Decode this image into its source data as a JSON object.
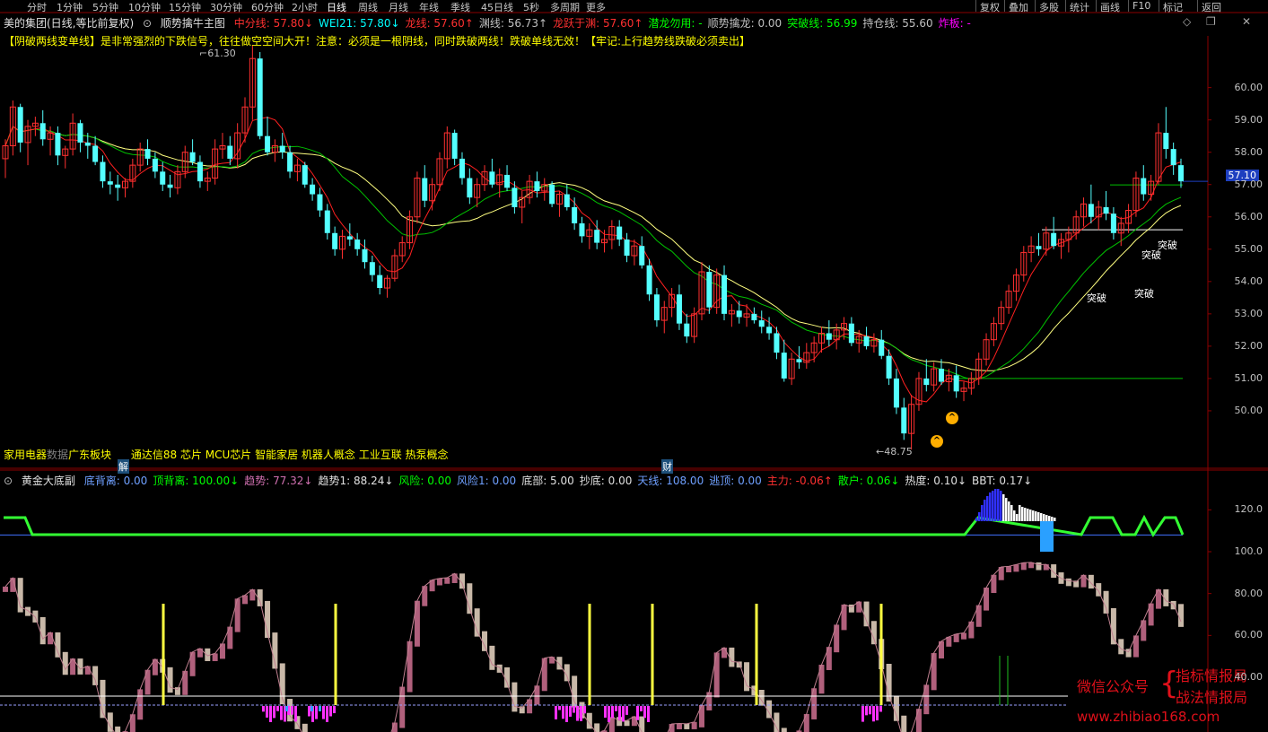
{
  "periods": [
    "分时",
    "1分钟",
    "5分钟",
    "10分钟",
    "15分钟",
    "30分钟",
    "60分钟",
    "2小时",
    "日线",
    "周线",
    "月线",
    "年线",
    "季线",
    "45日线",
    "5秒",
    "多周期",
    "更多"
  ],
  "active_period": "日线",
  "right_buttons": [
    "复权",
    "叠加",
    "多股",
    "统计",
    "画线",
    "F10",
    "标记",
    "返回"
  ],
  "header": {
    "stock_name": "美的集团(日线,等比前复权)",
    "indicator": "顺势擒牛主图",
    "items": [
      {
        "label": "中分线: 57.80↓",
        "color": "#ff3030"
      },
      {
        "label": "WEI21: 57.80↓",
        "color": "#00ffff"
      },
      {
        "label": "龙线: 57.60↑",
        "color": "#ff3030"
      },
      {
        "label": "渊线: 56.73↑",
        "color": "#c0c0c0"
      },
      {
        "label": "龙跃于渊: 57.60↑",
        "color": "#ff3030"
      },
      {
        "label": "潜龙勿用: -",
        "color": "#00ff00"
      },
      {
        "label": "顺势擒龙: 0.00",
        "color": "#c0c0c0"
      },
      {
        "label": "突破线: 56.99",
        "color": "#00ff00"
      },
      {
        "label": "持仓线: 55.60",
        "color": "#c0c0c0"
      },
      {
        "label": "炸板: -",
        "color": "#ff00ff"
      }
    ]
  },
  "notice": "【阴破两线变单线】是非常强烈的下跌信号，往往做空空间大开！注意：必须是一根阴线，同时跌破两线！跌破单线无效！【牢记:上行趋势线跌破必须卖出】",
  "high_label": "61.30",
  "low_label": "48.75",
  "current_price": "57.10",
  "price_axis": [
    "60.00",
    "59.00",
    "58.00",
    "57.00",
    "56.00",
    "55.00",
    "54.00",
    "53.00",
    "52.00",
    "51.00",
    "50.00"
  ],
  "sector": {
    "a": "家用电器",
    "b": "数据",
    "c": "广东板块",
    "d": "通达信88 芯片 MCU芯片 智能家居 机器人概念 工业互联 热泵概念"
  },
  "markers": {
    "jie": "解",
    "cai": "财"
  },
  "breakouts": [
    "突破",
    "突破",
    "突破",
    "突破"
  ],
  "sub_header": {
    "title": "黄金大底副",
    "items": [
      {
        "label": "底背离: 0.00",
        "color": "#6fa0ff"
      },
      {
        "label": "顶背离: 100.00↓",
        "color": "#00ff00"
      },
      {
        "label": "趋势: 77.32↓",
        "color": "#d070b0"
      },
      {
        "label": "趋势1: 88.24↓",
        "color": "#e0e0e0"
      },
      {
        "label": "风险: 0.00",
        "color": "#00ff00"
      },
      {
        "label": "风险1: 0.00",
        "color": "#6fa0ff"
      },
      {
        "label": "底部: 5.00",
        "color": "#e0e0e0"
      },
      {
        "label": "抄底: 0.00",
        "color": "#e0e0e0"
      },
      {
        "label": "天线: 108.00",
        "color": "#6fa0ff"
      },
      {
        "label": "逃顶: 0.00",
        "color": "#6fa0ff"
      },
      {
        "label": "主力: -0.06↑",
        "color": "#ff3030"
      },
      {
        "label": "散户: 0.06↓",
        "color": "#00ff00"
      },
      {
        "label": "热度: 0.10↓",
        "color": "#e0e0e0"
      },
      {
        "label": "BBT: 0.17↓",
        "color": "#e0e0e0"
      }
    ]
  },
  "sub_axis": [
    "120.0",
    "100.0",
    "80.00",
    "60.00",
    "40.00"
  ],
  "watermark": {
    "line1": "微信公众号",
    "line2a": "指标情报局",
    "line2b": "战法情报局",
    "url": "www.zhibiao168.com"
  },
  "colors": {
    "up": "#ff3030",
    "down": "#54ffff",
    "ma_red": "#ff2020",
    "ma_yellow": "#ffff80",
    "ma_green": "#00c000",
    "pink": "#b0607c",
    "beige": "#c8b8a8",
    "green_band": "#33ff33",
    "blue_band": "#3030ff"
  },
  "chart_data": {
    "type": "candlestick",
    "price_range": [
      48.5,
      61.6
    ],
    "candles": [
      [
        57.8,
        58.4,
        57.2,
        58.2
      ],
      [
        58.2,
        59.6,
        57.9,
        59.4
      ],
      [
        59.4,
        59.5,
        58.0,
        58.3
      ],
      [
        58.3,
        59.0,
        57.6,
        58.8
      ],
      [
        58.8,
        59.1,
        58.5,
        58.9
      ],
      [
        58.9,
        59.3,
        58.2,
        58.4
      ],
      [
        58.4,
        58.8,
        57.9,
        58.6
      ],
      [
        58.6,
        58.8,
        57.6,
        57.9
      ],
      [
        57.9,
        58.2,
        57.5,
        58.1
      ],
      [
        58.1,
        59.2,
        57.9,
        58.9
      ],
      [
        58.9,
        59.0,
        58.0,
        58.3
      ],
      [
        58.3,
        58.6,
        57.8,
        58.2
      ],
      [
        58.2,
        58.5,
        57.6,
        57.7
      ],
      [
        57.7,
        57.9,
        56.9,
        57.1
      ],
      [
        57.1,
        57.4,
        56.7,
        57.0
      ],
      [
        57.0,
        57.3,
        56.5,
        56.9
      ],
      [
        56.9,
        57.2,
        56.6,
        57.1
      ],
      [
        57.1,
        57.8,
        56.9,
        57.6
      ],
      [
        57.6,
        58.3,
        57.4,
        58.1
      ],
      [
        58.1,
        58.4,
        57.6,
        57.8
      ],
      [
        57.8,
        58.0,
        57.2,
        57.4
      ],
      [
        57.4,
        57.7,
        56.8,
        57.0
      ],
      [
        57.0,
        57.3,
        56.6,
        56.9
      ],
      [
        56.9,
        57.6,
        56.7,
        57.4
      ],
      [
        57.4,
        58.2,
        57.2,
        58.0
      ],
      [
        58.0,
        58.4,
        57.6,
        57.7
      ],
      [
        57.7,
        57.9,
        56.9,
        57.1
      ],
      [
        57.1,
        57.4,
        56.8,
        57.2
      ],
      [
        57.2,
        58.4,
        57.0,
        58.1
      ],
      [
        58.1,
        58.6,
        57.8,
        58.2
      ],
      [
        58.2,
        58.5,
        57.6,
        57.8
      ],
      [
        57.8,
        58.9,
        57.5,
        58.6
      ],
      [
        58.6,
        59.7,
        58.3,
        59.4
      ],
      [
        59.4,
        61.3,
        59.0,
        60.9
      ],
      [
        60.9,
        61.1,
        58.4,
        58.5
      ],
      [
        58.5,
        59.1,
        57.9,
        58.0
      ],
      [
        58.0,
        58.4,
        57.7,
        58.2
      ],
      [
        58.2,
        58.6,
        57.8,
        58.0
      ],
      [
        58.0,
        58.2,
        57.2,
        57.4
      ],
      [
        57.4,
        57.8,
        57.1,
        57.6
      ],
      [
        57.6,
        57.7,
        56.9,
        57.0
      ],
      [
        57.0,
        57.2,
        56.5,
        56.7
      ],
      [
        56.7,
        56.9,
        56.0,
        56.2
      ],
      [
        56.2,
        56.4,
        55.3,
        55.5
      ],
      [
        55.5,
        55.7,
        54.8,
        55.0
      ],
      [
        55.0,
        55.6,
        54.7,
        55.4
      ],
      [
        55.4,
        55.8,
        55.1,
        55.3
      ],
      [
        55.3,
        55.5,
        54.8,
        55.0
      ],
      [
        55.0,
        55.3,
        54.4,
        54.6
      ],
      [
        54.6,
        54.8,
        54.0,
        54.2
      ],
      [
        54.2,
        54.5,
        53.6,
        53.8
      ],
      [
        53.8,
        54.2,
        53.5,
        54.1
      ],
      [
        54.1,
        55.0,
        54.0,
        54.8
      ],
      [
        54.8,
        55.4,
        54.6,
        55.2
      ],
      [
        55.2,
        56.2,
        55.0,
        56.0
      ],
      [
        56.0,
        57.4,
        55.8,
        57.2
      ],
      [
        57.2,
        57.6,
        56.3,
        56.5
      ],
      [
        56.5,
        57.2,
        56.2,
        57.0
      ],
      [
        57.0,
        58.0,
        56.8,
        57.8
      ],
      [
        57.8,
        58.8,
        57.5,
        58.6
      ],
      [
        58.6,
        58.7,
        57.6,
        57.8
      ],
      [
        57.8,
        58.0,
        57.0,
        57.2
      ],
      [
        57.2,
        57.5,
        56.4,
        56.6
      ],
      [
        56.6,
        57.2,
        56.3,
        57.0
      ],
      [
        57.0,
        57.6,
        56.8,
        57.4
      ],
      [
        57.4,
        57.8,
        56.9,
        57.0
      ],
      [
        57.0,
        57.5,
        56.6,
        57.3
      ],
      [
        57.3,
        57.6,
        56.8,
        56.9
      ],
      [
        56.9,
        57.1,
        56.1,
        56.3
      ],
      [
        56.3,
        56.8,
        55.8,
        56.6
      ],
      [
        56.6,
        57.3,
        56.4,
        57.1
      ],
      [
        57.1,
        57.4,
        56.6,
        56.8
      ],
      [
        56.8,
        57.2,
        56.5,
        57.0
      ],
      [
        57.0,
        57.1,
        56.3,
        56.4
      ],
      [
        56.4,
        56.8,
        56.0,
        56.7
      ],
      [
        56.7,
        57.0,
        56.2,
        56.3
      ],
      [
        56.3,
        56.6,
        55.6,
        55.8
      ],
      [
        55.8,
        56.0,
        55.2,
        55.4
      ],
      [
        55.4,
        55.8,
        55.0,
        55.6
      ],
      [
        55.6,
        55.9,
        55.0,
        55.2
      ],
      [
        55.2,
        55.6,
        54.9,
        55.3
      ],
      [
        55.3,
        55.9,
        55.0,
        55.7
      ],
      [
        55.7,
        55.9,
        55.1,
        55.3
      ],
      [
        55.3,
        55.5,
        54.6,
        54.8
      ],
      [
        54.8,
        55.3,
        54.5,
        55.1
      ],
      [
        55.1,
        55.4,
        54.4,
        54.5
      ],
      [
        54.5,
        54.7,
        53.4,
        53.6
      ],
      [
        53.6,
        53.8,
        52.6,
        52.8
      ],
      [
        52.8,
        53.4,
        52.4,
        53.2
      ],
      [
        53.2,
        53.8,
        52.9,
        53.6
      ],
      [
        53.6,
        53.9,
        52.5,
        52.7
      ],
      [
        52.7,
        53.0,
        52.1,
        52.3
      ],
      [
        52.3,
        53.2,
        52.1,
        53.0
      ],
      [
        53.0,
        54.6,
        52.8,
        54.3
      ],
      [
        54.3,
        54.5,
        53.0,
        53.2
      ],
      [
        53.2,
        54.4,
        53.0,
        54.2
      ],
      [
        54.2,
        54.5,
        52.8,
        53.0
      ],
      [
        53.0,
        53.3,
        52.6,
        53.1
      ],
      [
        53.1,
        53.4,
        52.7,
        52.9
      ],
      [
        52.9,
        53.3,
        52.6,
        53.0
      ],
      [
        53.0,
        53.2,
        52.7,
        52.8
      ],
      [
        52.8,
        53.1,
        52.4,
        52.6
      ],
      [
        52.6,
        52.9,
        52.2,
        52.4
      ],
      [
        52.4,
        52.6,
        51.6,
        51.8
      ],
      [
        51.8,
        52.2,
        50.9,
        51.0
      ],
      [
        51.0,
        51.8,
        50.8,
        51.6
      ],
      [
        51.6,
        52.0,
        51.3,
        51.5
      ],
      [
        51.5,
        52.1,
        51.3,
        51.8
      ],
      [
        51.8,
        52.3,
        51.5,
        52.1
      ],
      [
        52.1,
        52.6,
        51.8,
        52.4
      ],
      [
        52.4,
        52.8,
        52.0,
        52.2
      ],
      [
        52.2,
        52.7,
        51.9,
        52.5
      ],
      [
        52.5,
        52.9,
        52.2,
        52.7
      ],
      [
        52.7,
        52.9,
        52.0,
        52.1
      ],
      [
        52.1,
        52.5,
        51.8,
        52.3
      ],
      [
        52.3,
        52.6,
        51.9,
        52.0
      ],
      [
        52.0,
        52.4,
        51.8,
        52.2
      ],
      [
        52.2,
        52.5,
        51.6,
        51.7
      ],
      [
        51.7,
        51.9,
        50.8,
        51.0
      ],
      [
        51.0,
        51.3,
        49.9,
        50.1
      ],
      [
        50.1,
        50.4,
        49.1,
        49.3
      ],
      [
        49.3,
        50.5,
        48.8,
        50.2
      ],
      [
        50.2,
        51.2,
        50.0,
        51.0
      ],
      [
        51.0,
        51.6,
        50.6,
        50.8
      ],
      [
        50.8,
        51.5,
        50.6,
        51.3
      ],
      [
        51.3,
        51.6,
        50.8,
        50.9
      ],
      [
        50.9,
        51.3,
        50.6,
        51.1
      ],
      [
        51.1,
        51.4,
        50.4,
        50.6
      ],
      [
        50.6,
        50.9,
        50.3,
        50.7
      ],
      [
        50.7,
        51.2,
        50.5,
        51.0
      ],
      [
        51.0,
        51.8,
        50.8,
        51.6
      ],
      [
        51.6,
        52.4,
        51.4,
        52.2
      ],
      [
        52.2,
        52.9,
        52.0,
        52.7
      ],
      [
        52.7,
        53.4,
        52.5,
        53.2
      ],
      [
        53.2,
        53.9,
        53.0,
        53.7
      ],
      [
        53.7,
        54.4,
        53.4,
        54.2
      ],
      [
        54.2,
        55.1,
        54.0,
        54.9
      ],
      [
        54.9,
        55.4,
        54.6,
        55.1
      ],
      [
        55.1,
        55.5,
        54.8,
        55.0
      ],
      [
        55.0,
        55.7,
        54.8,
        55.5
      ],
      [
        55.5,
        56.0,
        55.0,
        55.1
      ],
      [
        55.1,
        55.5,
        54.7,
        55.3
      ],
      [
        55.3,
        55.7,
        54.9,
        55.5
      ],
      [
        55.5,
        56.2,
        55.3,
        56.0
      ],
      [
        56.0,
        56.6,
        55.7,
        56.4
      ],
      [
        56.4,
        57.0,
        55.8,
        56.0
      ],
      [
        56.0,
        56.5,
        55.6,
        56.3
      ],
      [
        56.3,
        56.8,
        55.9,
        56.1
      ],
      [
        56.1,
        56.3,
        55.3,
        55.5
      ],
      [
        55.5,
        56.0,
        55.1,
        55.8
      ],
      [
        55.8,
        56.4,
        55.5,
        56.2
      ],
      [
        56.2,
        57.4,
        56.0,
        57.2
      ],
      [
        57.2,
        57.6,
        56.5,
        56.7
      ],
      [
        56.7,
        57.3,
        56.5,
        57.1
      ],
      [
        57.1,
        58.9,
        57.0,
        58.6
      ],
      [
        58.6,
        59.4,
        57.8,
        58.1
      ],
      [
        58.1,
        58.3,
        57.3,
        57.6
      ],
      [
        57.6,
        57.8,
        56.9,
        57.1
      ]
    ],
    "sub_range": [
      25,
      130
    ]
  }
}
